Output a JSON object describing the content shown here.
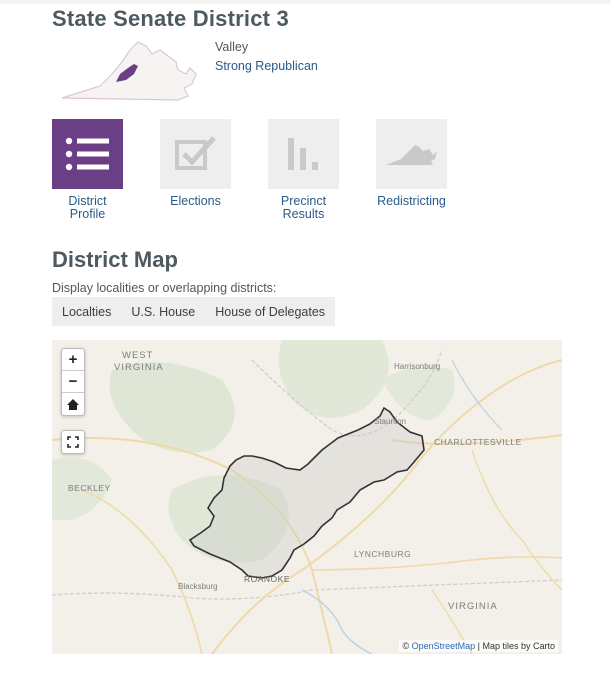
{
  "header": {
    "title": "State Senate District 3",
    "region": "Valley",
    "rating": "Strong Republican"
  },
  "nav": {
    "tiles": [
      {
        "label_line1": "District",
        "label_line2": "Profile",
        "active": true
      },
      {
        "label_line1": "Elections",
        "label_line2": "",
        "active": false
      },
      {
        "label_line1": "Precinct",
        "label_line2": "Results",
        "active": false
      },
      {
        "label_line1": "Redistricting",
        "label_line2": "",
        "active": false
      }
    ]
  },
  "district_map": {
    "title": "District Map",
    "hint": "Display localities or overlapping districts:",
    "options": [
      "Localties",
      "U.S. House",
      "House of Delegates"
    ]
  },
  "map": {
    "zoom_in": "+",
    "zoom_out": "−",
    "labels": {
      "west_virginia_1": "WEST",
      "west_virginia_2": "VIRGINIA",
      "harrisonburg": "Harrisonburg",
      "staunton": "Staunton",
      "charlottesville": "CHARLOTTESVILLE",
      "beckley": "BECKLEY",
      "lynchburg": "LYNCHBURG",
      "blacksburg": "Blacksburg",
      "roanoke": "ROANOKE",
      "virginia": "VIRGINIA"
    },
    "attribution_prefix": "© ",
    "attribution_link": "OpenStreetMap",
    "attribution_suffix": " | Map tiles by Carto"
  },
  "colors": {
    "accent": "#6b3f86",
    "link": "#2a5a8a",
    "tile_bg": "#eeeeee"
  }
}
